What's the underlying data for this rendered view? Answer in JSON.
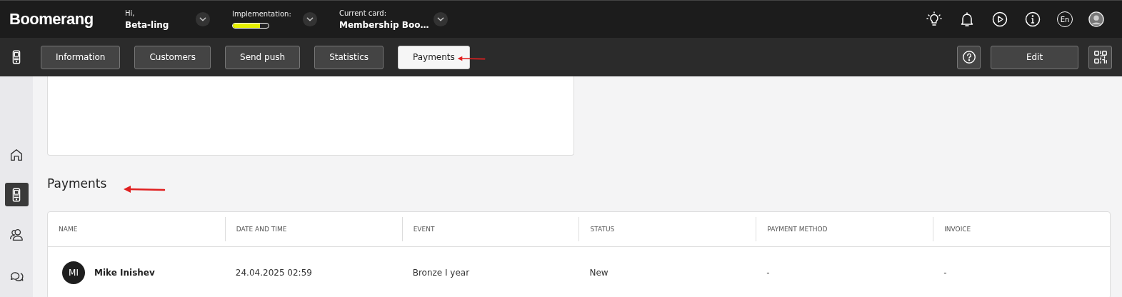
{
  "header": {
    "logo": "Boomerang",
    "user": {
      "label": "Hi,",
      "value": "Beta-ling"
    },
    "implementation": {
      "label": "Implementation:",
      "level": 0.75
    },
    "current_card": {
      "label": "Current card:",
      "value": "Membership Boo…"
    },
    "language": "En"
  },
  "tabs": [
    {
      "label": "Information",
      "selected": false
    },
    {
      "label": "Customers",
      "selected": false
    },
    {
      "label": "Send push",
      "selected": false
    },
    {
      "label": "Statistics",
      "selected": false
    },
    {
      "label": "Payments",
      "selected": true
    }
  ],
  "toolbar": {
    "edit": "Edit"
  },
  "sidebar": {
    "items": [
      {
        "kind": "home",
        "selected": false
      },
      {
        "kind": "phone",
        "selected": true
      },
      {
        "kind": "users",
        "selected": false
      },
      {
        "kind": "chat",
        "selected": false
      }
    ]
  },
  "payments": {
    "title": "Payments",
    "columns": [
      "NAME",
      "DATE AND TIME",
      "EVENT",
      "STATUS",
      "PAYMENT METHOD",
      "INVOICE"
    ],
    "rows": [
      {
        "cells": [
          {
            "initials": "MI",
            "name": "Mike Inishev"
          },
          "24.04.2025 02:59",
          "Bronze I year",
          "New",
          "-",
          "-"
        ]
      }
    ]
  }
}
